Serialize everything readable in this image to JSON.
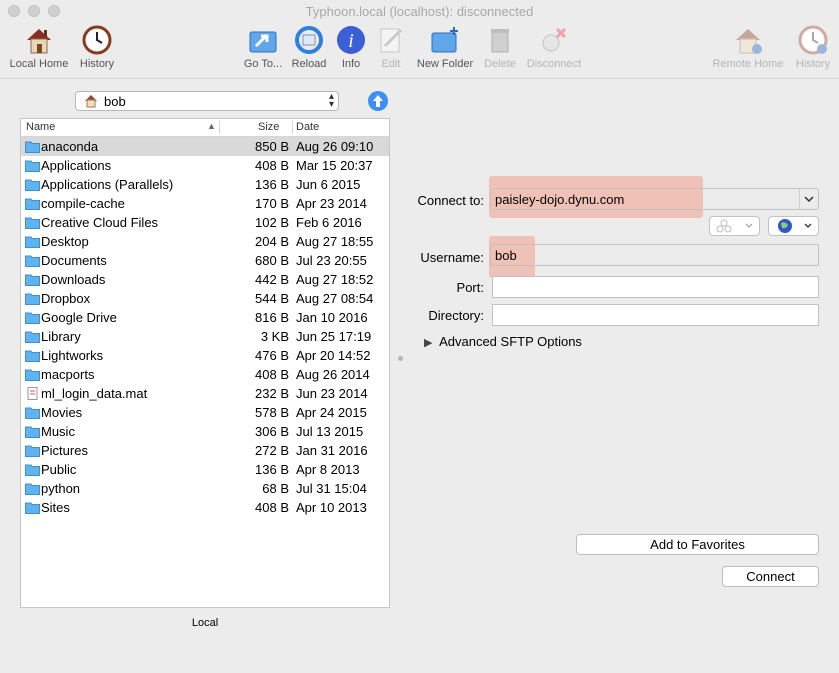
{
  "window": {
    "title": "Typhoon.local (localhost): disconnected"
  },
  "toolbar": {
    "local_home": "Local Home",
    "history": "History",
    "go_to": "Go To...",
    "reload": "Reload",
    "info": "Info",
    "edit": "Edit",
    "new_folder": "New Folder",
    "delete": "Delete",
    "disconnect": "Disconnect",
    "remote_home": "Remote Home",
    "remote_history": "History"
  },
  "local": {
    "path": "bob",
    "columns": {
      "name": "Name",
      "size": "Size",
      "date": "Date"
    },
    "files": [
      {
        "name": "anaconda",
        "size": "850 B",
        "date": "Aug 26 09:10",
        "icon": "folder-icon",
        "selected": true
      },
      {
        "name": "Applications",
        "size": "408 B",
        "date": "Mar 15 20:37",
        "icon": "applications-folder-icon"
      },
      {
        "name": "Applications (Parallels)",
        "size": "136 B",
        "date": "Jun 6 2015",
        "icon": "parallels-folder-icon"
      },
      {
        "name": "compile-cache",
        "size": "170 B",
        "date": "Apr 23 2014",
        "icon": "folder-icon"
      },
      {
        "name": "Creative Cloud Files",
        "size": "102 B",
        "date": "Feb 6 2016",
        "icon": "creative-cloud-folder-icon"
      },
      {
        "name": "Desktop",
        "size": "204 B",
        "date": "Aug 27 18:55",
        "icon": "desktop-folder-icon"
      },
      {
        "name": "Documents",
        "size": "680 B",
        "date": "Jul 23 20:55",
        "icon": "documents-folder-icon"
      },
      {
        "name": "Downloads",
        "size": "442 B",
        "date": "Aug 27 18:52",
        "icon": "downloads-folder-icon"
      },
      {
        "name": "Dropbox",
        "size": "544 B",
        "date": "Aug 27 08:54",
        "icon": "dropbox-folder-icon"
      },
      {
        "name": "Google Drive",
        "size": "816 B",
        "date": "Jan 10 2016",
        "icon": "google-drive-folder-icon"
      },
      {
        "name": "Library",
        "size": "3 KB",
        "date": "Jun 25 17:19",
        "icon": "library-folder-icon"
      },
      {
        "name": "Lightworks",
        "size": "476 B",
        "date": "Apr 20 14:52",
        "icon": "folder-icon"
      },
      {
        "name": "macports",
        "size": "408 B",
        "date": "Aug 26 2014",
        "icon": "folder-icon"
      },
      {
        "name": "ml_login_data.mat",
        "size": "232 B",
        "date": "Jun 23 2014",
        "icon": "mat-file-icon"
      },
      {
        "name": "Movies",
        "size": "578 B",
        "date": "Apr 24 2015",
        "icon": "movies-folder-icon"
      },
      {
        "name": "Music",
        "size": "306 B",
        "date": "Jul 13 2015",
        "icon": "music-folder-icon"
      },
      {
        "name": "Pictures",
        "size": "272 B",
        "date": "Jan 31 2016",
        "icon": "pictures-folder-icon"
      },
      {
        "name": "Public",
        "size": "136 B",
        "date": "Apr 8 2013",
        "icon": "public-folder-icon"
      },
      {
        "name": "python",
        "size": "68 B",
        "date": "Jul 31 15:04",
        "icon": "folder-icon"
      },
      {
        "name": "Sites",
        "size": "408 B",
        "date": "Apr 10 2013",
        "icon": "sites-folder-icon"
      }
    ],
    "label": "Local"
  },
  "connect": {
    "connect_to_label": "Connect to:",
    "host": "paisley-dojo.dynu.com",
    "username_label": "Username:",
    "username": "bob",
    "port_label": "Port:",
    "port": "",
    "directory_label": "Directory:",
    "directory": "",
    "advanced": "Advanced SFTP Options",
    "add_favorites": "Add to Favorites",
    "connect_button": "Connect"
  },
  "colors": {
    "folder_blue": "#5fb3f0",
    "highlight": "#f4a08c",
    "selection": "#d9d9d9",
    "accent": "#3d8ff5"
  }
}
